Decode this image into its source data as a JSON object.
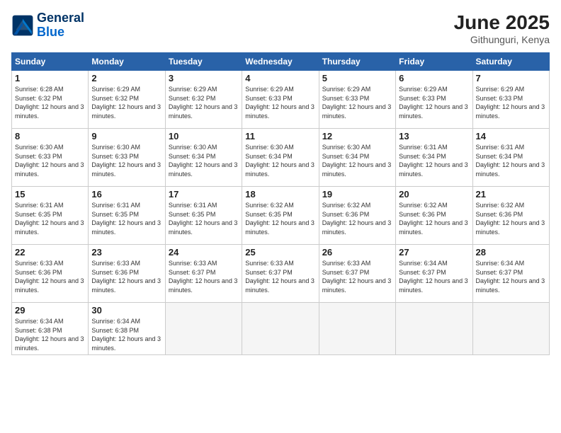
{
  "logo": {
    "line1": "General",
    "line2": "Blue"
  },
  "title": "June 2025",
  "subtitle": "Githunguri, Kenya",
  "days_of_week": [
    "Sunday",
    "Monday",
    "Tuesday",
    "Wednesday",
    "Thursday",
    "Friday",
    "Saturday"
  ],
  "weeks": [
    [
      {
        "num": "1",
        "sunrise": "6:28 AM",
        "sunset": "6:32 PM",
        "daylight": "12 hours and 3 minutes."
      },
      {
        "num": "2",
        "sunrise": "6:29 AM",
        "sunset": "6:32 PM",
        "daylight": "12 hours and 3 minutes."
      },
      {
        "num": "3",
        "sunrise": "6:29 AM",
        "sunset": "6:32 PM",
        "daylight": "12 hours and 3 minutes."
      },
      {
        "num": "4",
        "sunrise": "6:29 AM",
        "sunset": "6:33 PM",
        "daylight": "12 hours and 3 minutes."
      },
      {
        "num": "5",
        "sunrise": "6:29 AM",
        "sunset": "6:33 PM",
        "daylight": "12 hours and 3 minutes."
      },
      {
        "num": "6",
        "sunrise": "6:29 AM",
        "sunset": "6:33 PM",
        "daylight": "12 hours and 3 minutes."
      },
      {
        "num": "7",
        "sunrise": "6:29 AM",
        "sunset": "6:33 PM",
        "daylight": "12 hours and 3 minutes."
      }
    ],
    [
      {
        "num": "8",
        "sunrise": "6:30 AM",
        "sunset": "6:33 PM",
        "daylight": "12 hours and 3 minutes."
      },
      {
        "num": "9",
        "sunrise": "6:30 AM",
        "sunset": "6:33 PM",
        "daylight": "12 hours and 3 minutes."
      },
      {
        "num": "10",
        "sunrise": "6:30 AM",
        "sunset": "6:34 PM",
        "daylight": "12 hours and 3 minutes."
      },
      {
        "num": "11",
        "sunrise": "6:30 AM",
        "sunset": "6:34 PM",
        "daylight": "12 hours and 3 minutes."
      },
      {
        "num": "12",
        "sunrise": "6:30 AM",
        "sunset": "6:34 PM",
        "daylight": "12 hours and 3 minutes."
      },
      {
        "num": "13",
        "sunrise": "6:31 AM",
        "sunset": "6:34 PM",
        "daylight": "12 hours and 3 minutes."
      },
      {
        "num": "14",
        "sunrise": "6:31 AM",
        "sunset": "6:34 PM",
        "daylight": "12 hours and 3 minutes."
      }
    ],
    [
      {
        "num": "15",
        "sunrise": "6:31 AM",
        "sunset": "6:35 PM",
        "daylight": "12 hours and 3 minutes."
      },
      {
        "num": "16",
        "sunrise": "6:31 AM",
        "sunset": "6:35 PM",
        "daylight": "12 hours and 3 minutes."
      },
      {
        "num": "17",
        "sunrise": "6:31 AM",
        "sunset": "6:35 PM",
        "daylight": "12 hours and 3 minutes."
      },
      {
        "num": "18",
        "sunrise": "6:32 AM",
        "sunset": "6:35 PM",
        "daylight": "12 hours and 3 minutes."
      },
      {
        "num": "19",
        "sunrise": "6:32 AM",
        "sunset": "6:36 PM",
        "daylight": "12 hours and 3 minutes."
      },
      {
        "num": "20",
        "sunrise": "6:32 AM",
        "sunset": "6:36 PM",
        "daylight": "12 hours and 3 minutes."
      },
      {
        "num": "21",
        "sunrise": "6:32 AM",
        "sunset": "6:36 PM",
        "daylight": "12 hours and 3 minutes."
      }
    ],
    [
      {
        "num": "22",
        "sunrise": "6:33 AM",
        "sunset": "6:36 PM",
        "daylight": "12 hours and 3 minutes."
      },
      {
        "num": "23",
        "sunrise": "6:33 AM",
        "sunset": "6:36 PM",
        "daylight": "12 hours and 3 minutes."
      },
      {
        "num": "24",
        "sunrise": "6:33 AM",
        "sunset": "6:37 PM",
        "daylight": "12 hours and 3 minutes."
      },
      {
        "num": "25",
        "sunrise": "6:33 AM",
        "sunset": "6:37 PM",
        "daylight": "12 hours and 3 minutes."
      },
      {
        "num": "26",
        "sunrise": "6:33 AM",
        "sunset": "6:37 PM",
        "daylight": "12 hours and 3 minutes."
      },
      {
        "num": "27",
        "sunrise": "6:34 AM",
        "sunset": "6:37 PM",
        "daylight": "12 hours and 3 minutes."
      },
      {
        "num": "28",
        "sunrise": "6:34 AM",
        "sunset": "6:37 PM",
        "daylight": "12 hours and 3 minutes."
      }
    ],
    [
      {
        "num": "29",
        "sunrise": "6:34 AM",
        "sunset": "6:38 PM",
        "daylight": "12 hours and 3 minutes."
      },
      {
        "num": "30",
        "sunrise": "6:34 AM",
        "sunset": "6:38 PM",
        "daylight": "12 hours and 3 minutes."
      },
      null,
      null,
      null,
      null,
      null
    ]
  ]
}
